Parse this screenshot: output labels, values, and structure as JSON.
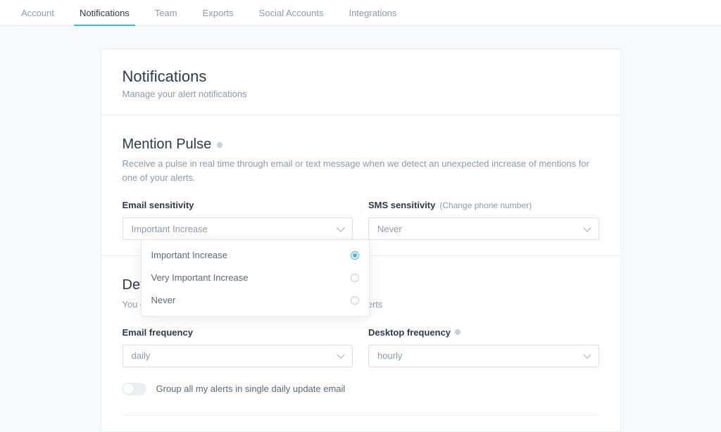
{
  "tabs": {
    "account": "Account",
    "notifications": "Notifications",
    "team": "Team",
    "exports": "Exports",
    "social": "Social Accounts",
    "integrations": "Integrations"
  },
  "header": {
    "title": "Notifications",
    "subtitle": "Manage your alert notifications"
  },
  "pulse": {
    "title": "Mention Pulse",
    "desc": "Receive a pulse in real time through email or text message when we detect an unexpected increase of mentions for one of your alerts.",
    "email_label": "Email sensitivity",
    "email_value": "Important Increase",
    "sms_label": "SMS sensitivity",
    "sms_sublink": "(Change phone number)",
    "sms_value": "Never",
    "options": {
      "important": "Important Increase",
      "very_important": "Very Important Increase",
      "never": "Never"
    }
  },
  "defaults": {
    "title_partial": "Def",
    "desc_partial_left": "You c",
    "desc_partial_right": "ions of your alerts",
    "email_label": "Email frequency",
    "email_value": "daily",
    "desktop_label": "Desktop frequency",
    "desktop_value": "hourly",
    "toggle_label": "Group all my alerts in single daily update email"
  }
}
